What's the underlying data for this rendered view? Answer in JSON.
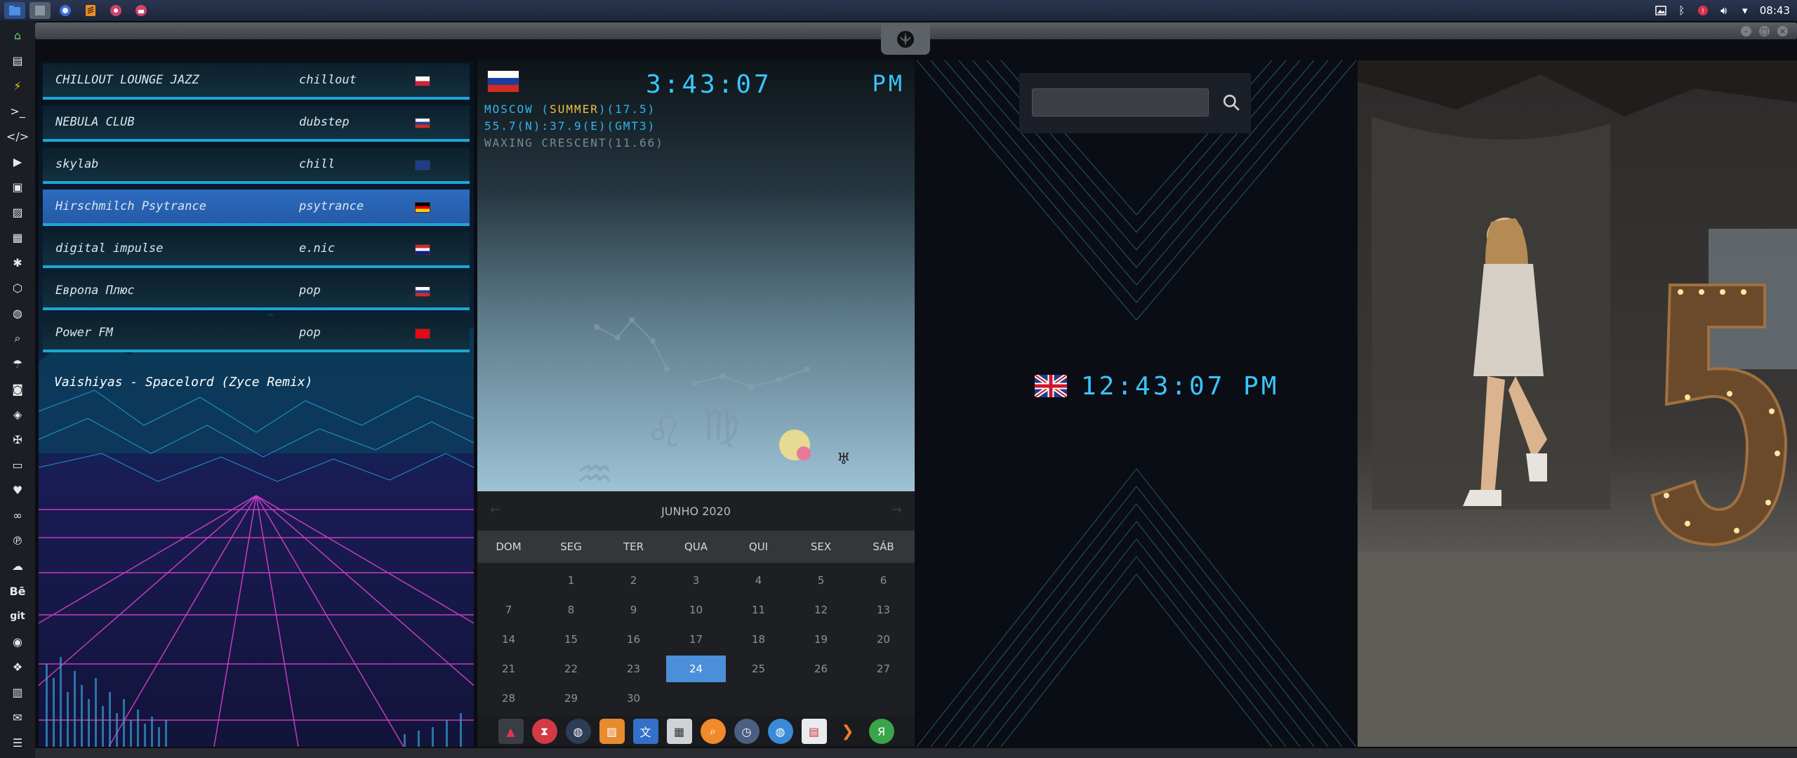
{
  "top_panel": {
    "launchers": [
      "files-icon",
      "window-icon",
      "browser-icon",
      "sublime-icon",
      "radio-icon",
      "radio-tray-icon"
    ],
    "clock": "08:43"
  },
  "radio": {
    "stations": [
      {
        "name": "CHILLOUT LOUNGE JAZZ",
        "genre": "chillout",
        "flag": "pl"
      },
      {
        "name": "NEBULA CLUB",
        "genre": "dubstep",
        "flag": "ru"
      },
      {
        "name": "skylab",
        "genre": "chill",
        "flag": "gb"
      },
      {
        "name": "Hirschmilch Psytrance",
        "genre": "psytrance",
        "flag": "de"
      },
      {
        "name": "digital impulse",
        "genre": "e.nic",
        "flag": "hr"
      },
      {
        "name": "Европа Плюс",
        "genre": "pop",
        "flag": "ru"
      },
      {
        "name": "Power FM",
        "genre": "pop",
        "flag": "tr"
      }
    ],
    "active_index": 3,
    "now_playing": "Vaishiyas - Spacelord (Zyce Remix)"
  },
  "weather": {
    "time": "3:43:07",
    "ampm": "PM",
    "line1_pre": "MOSCOW (",
    "line1_hl": "SUMMER",
    "line1_post": ")(17.5)",
    "line2": "55.7(N):37.9(E)(GMT3)",
    "line3": "WAXING CRESCENT(11.66)"
  },
  "calendar": {
    "month": "JUNHO 2020",
    "weekdays": [
      "DOM",
      "SEG",
      "TER",
      "QUA",
      "QUI",
      "SEX",
      "SÁB"
    ],
    "days": [
      "",
      "1",
      "2",
      "3",
      "4",
      "5",
      "6",
      "7",
      "8",
      "9",
      "10",
      "11",
      "12",
      "13",
      "14",
      "15",
      "16",
      "17",
      "18",
      "19",
      "20",
      "21",
      "22",
      "23",
      "24",
      "25",
      "26",
      "27",
      "28",
      "29",
      "30"
    ],
    "today": "24"
  },
  "world_clock": {
    "time": "12:43:07 PM",
    "search_placeholder": ""
  },
  "colors": {
    "accent": "#39c6ff",
    "active_station": "#2d6cc0",
    "calendar_today": "#4a8fd8",
    "highlight": "#f0c040"
  }
}
